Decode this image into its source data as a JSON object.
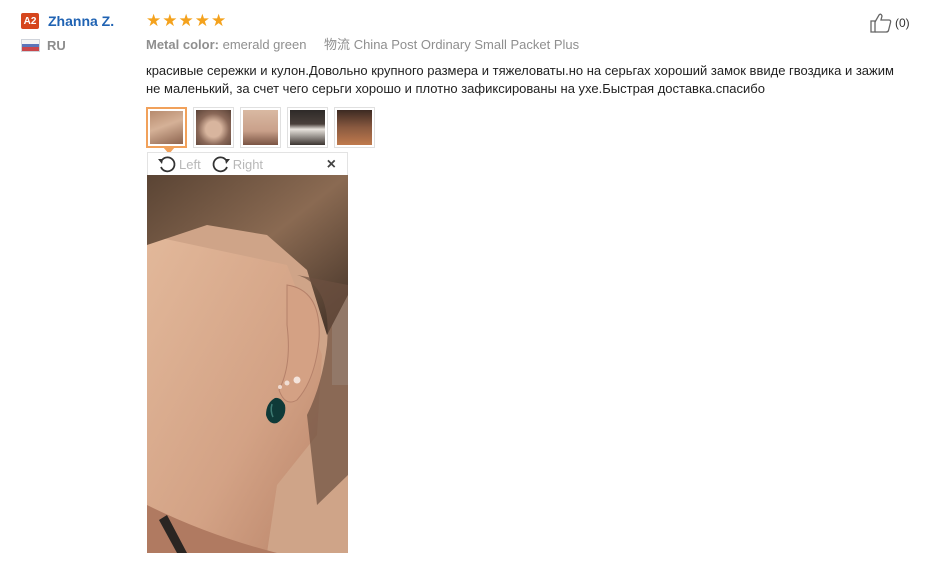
{
  "user": {
    "level_badge": "A2",
    "name": "Zhanna Z.",
    "country": "RU"
  },
  "review": {
    "rating": 5,
    "metal_label": "Metal color:",
    "metal_value": "emerald green",
    "shipping_label": "物流",
    "shipping_value": "China Post Ordinary Small Packet Plus",
    "text": "красивые сережки и кулон.Довольно крупного размера и тяжеловаты.но на серьгах хороший замок ввиде гвоздика и зажим не маленький, за счет чего серьги хорошо и плотно зафиксированы на ухе.Быстрая доставка.спасибо",
    "photo_count": 5,
    "selected_photo": 1
  },
  "viewer": {
    "rotate_left": "Left",
    "rotate_right": "Right",
    "close_glyph": "×"
  },
  "helpful": {
    "count": "(0)",
    "icon": "thumbs-up-icon"
  },
  "colors": {
    "username": "#2063b3",
    "badge": "#d6461d",
    "stars": "#f4a21d",
    "active_thumb_border": "#f1a15b"
  }
}
